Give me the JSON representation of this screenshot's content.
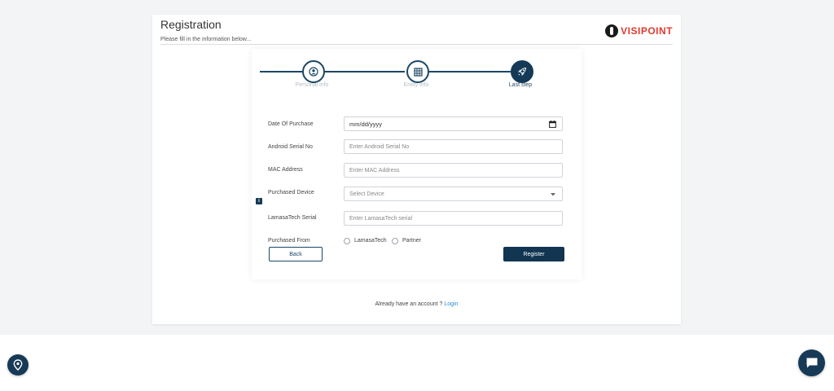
{
  "header": {
    "title": "Registration",
    "subtitle": "Please fill in the information below...",
    "logo_text": "VISIPOINT",
    "logo_color": "#e23b2e"
  },
  "steps": [
    {
      "label": "Personal info",
      "icon": "user-icon",
      "state": "done"
    },
    {
      "label": "Entity info",
      "icon": "grid-icon",
      "state": "done"
    },
    {
      "label": "Last step",
      "icon": "rocket-icon",
      "state": "active"
    }
  ],
  "form": {
    "date_of_purchase": {
      "label": "Date Of Purchase",
      "value": "mm/dd/yyyy"
    },
    "android_serial": {
      "label": "Android Serial No",
      "placeholder": "Enter Android Serial No"
    },
    "mac_address": {
      "label": "MAC Address",
      "placeholder": "Enter MAC Address"
    },
    "purchased_device": {
      "label": "Purchased Device",
      "value": "Select Device"
    },
    "lamasatech_serial": {
      "label": "LamasaTech Serial",
      "placeholder": "Enter LamasaTech serial",
      "info_badge": "i"
    },
    "purchased_from": {
      "label": "Purchased From",
      "options": [
        "LamasaTech",
        "Partner"
      ]
    }
  },
  "buttons": {
    "back": "Back",
    "register": "Register"
  },
  "footer": {
    "account_text": "Already have an account ?",
    "login_link": "Login"
  },
  "colors": {
    "primary": "#143a57",
    "link": "#2a8bd1"
  }
}
